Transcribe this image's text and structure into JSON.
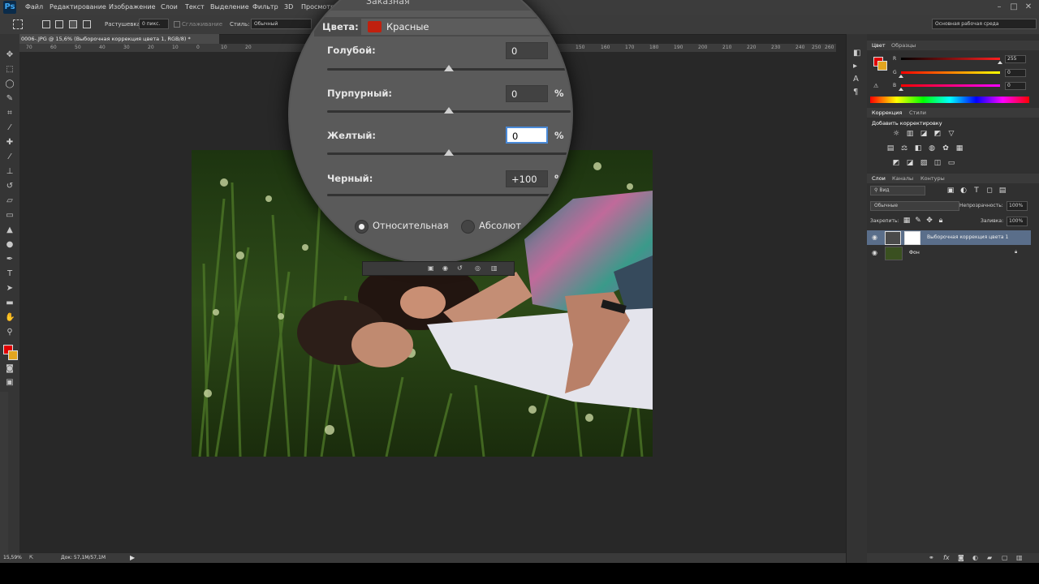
{
  "app": {
    "logo": "Ps",
    "menu": [
      "Файл",
      "Редактирование",
      "Изображение",
      "Слои",
      "Текст",
      "Выделение",
      "Фильтр",
      "3D",
      "Просмотр"
    ],
    "window_controls": [
      "–",
      "□",
      "✕"
    ]
  },
  "options_bar": {
    "feather_label": "Растушевка:",
    "feather_value": "0 пикс.",
    "antialias_label": "Сглаживание",
    "style_label": "Стиль:",
    "style_value": "Обычный",
    "workspace": "Основная рабочая среда"
  },
  "document": {
    "tab_title": "0006-.JPG @ 15,6% (Выборочная коррекция цвета 1, RGB/8) *",
    "ruler_ticks": [
      "70",
      "60",
      "50",
      "40",
      "30",
      "20",
      "10",
      "0",
      "10",
      "20",
      "150",
      "160",
      "170",
      "180",
      "190",
      "200",
      "210",
      "220",
      "230",
      "240",
      "250",
      "260"
    ]
  },
  "magnifier": {
    "top_label": "Заказная",
    "colors_label": "Цвета:",
    "colors_value": "Красные",
    "colors_swatch": "#c0200e",
    "rows": [
      {
        "label": "Голубой:",
        "value": "0",
        "unit": "",
        "thumb": 0.5
      },
      {
        "label": "Пурпурный:",
        "value": "0",
        "unit": "%",
        "thumb": 0.5
      },
      {
        "label": "Желтый:",
        "value": "0",
        "unit": "%",
        "thumb": 0.5
      },
      {
        "label": "Черный:",
        "value": "+100",
        "unit": "%",
        "thumb": 1.0
      }
    ],
    "relative_label": "Относительная",
    "absolute_label": "Абсолют"
  },
  "status": {
    "zoom": "15,59%",
    "doc": "Док: 57,1M/57,1M"
  },
  "panels": {
    "color_tabs": [
      "Цвет",
      "Образцы"
    ],
    "color_channels": [
      {
        "name": "R",
        "value": "255",
        "gradient": "linear-gradient(90deg,#000,#ff2020)",
        "fill": 1.0
      },
      {
        "name": "G",
        "value": "0",
        "gradient": "linear-gradient(90deg,#ff0000,#ffff00)",
        "fill": 0.0
      },
      {
        "name": "B",
        "value": "0",
        "gradient": "linear-gradient(90deg,#ff0000,#ff00ff)",
        "fill": 0.0
      }
    ],
    "adj_tabs": [
      "Коррекция",
      "Стили"
    ],
    "add_adjustment": "Добавить корректировку",
    "layers_tabs": [
      "Слои",
      "Каналы",
      "Контуры"
    ],
    "kind_value": "Вид",
    "blend_mode": "Обычные",
    "opacity_label": "Непрозрачность:",
    "opacity_value": "100%",
    "lock_label": "Закрепить:",
    "fill_label": "Заливка:",
    "fill_value": "100%",
    "layers": [
      {
        "name": "Выборочная коррекция цвета 1"
      },
      {
        "name": "Фон"
      }
    ]
  },
  "colors": {
    "foreground": "#e00000",
    "background": "#e2a520"
  }
}
